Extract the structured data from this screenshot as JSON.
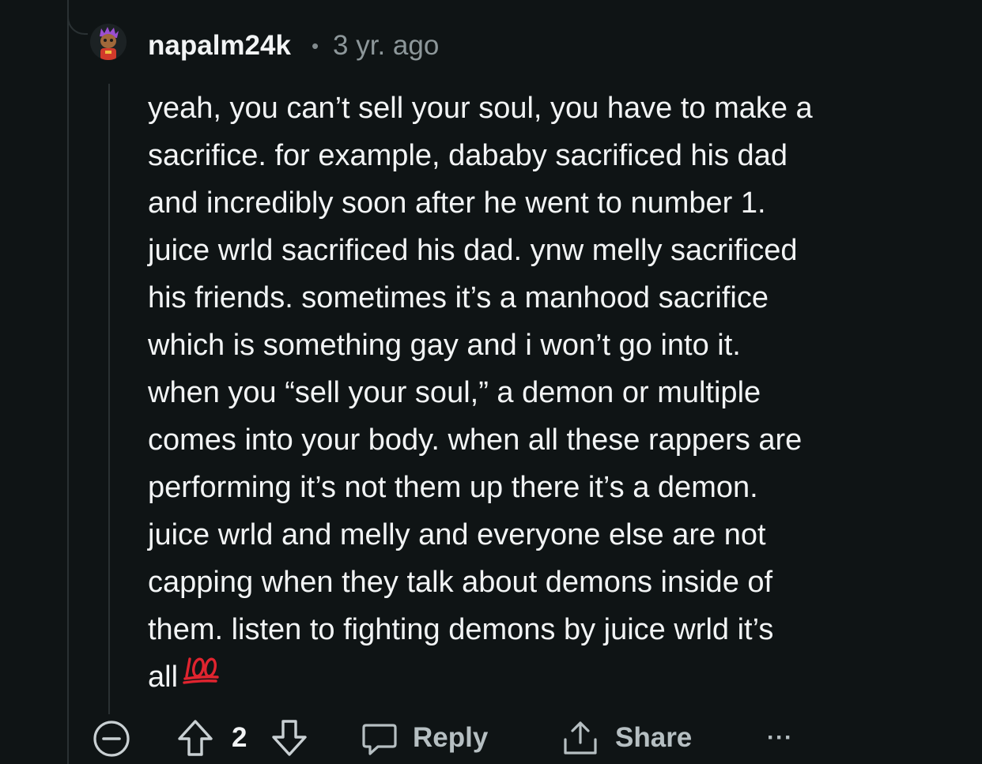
{
  "comment": {
    "author": "napalm24k",
    "separator": "•",
    "time": "3 yr. ago",
    "body_lines": [
      "yeah, you can’t sell your soul, you have to make a",
      "sacrifice. for example, dababy sacrificed his dad",
      "and incredibly soon after he went to number 1.",
      "juice wrld sacrificed his dad. ynw melly sacrificed",
      "his friends. sometimes it’s a manhood sacrifice",
      "which is something gay and i won’t go into it.",
      "when you “sell your soul,” a demon or multiple",
      "comes into your body. when all these rappers are",
      "performing it’s not them up there it’s a demon.",
      "juice wrld and melly and everyone else are not",
      "capping when they talk about demons inside of",
      "them. listen to fighting demons by juice wrld it’s",
      "all"
    ],
    "emoji": "hundred-points-icon",
    "vote_count": "2"
  },
  "actions": {
    "reply_label": "Reply",
    "share_label": "Share",
    "more_label": "···"
  },
  "colors": {
    "background": "#0f1415",
    "text": "#f2f4f5",
    "muted": "#8d979a",
    "emoji_red": "#e0242f"
  }
}
